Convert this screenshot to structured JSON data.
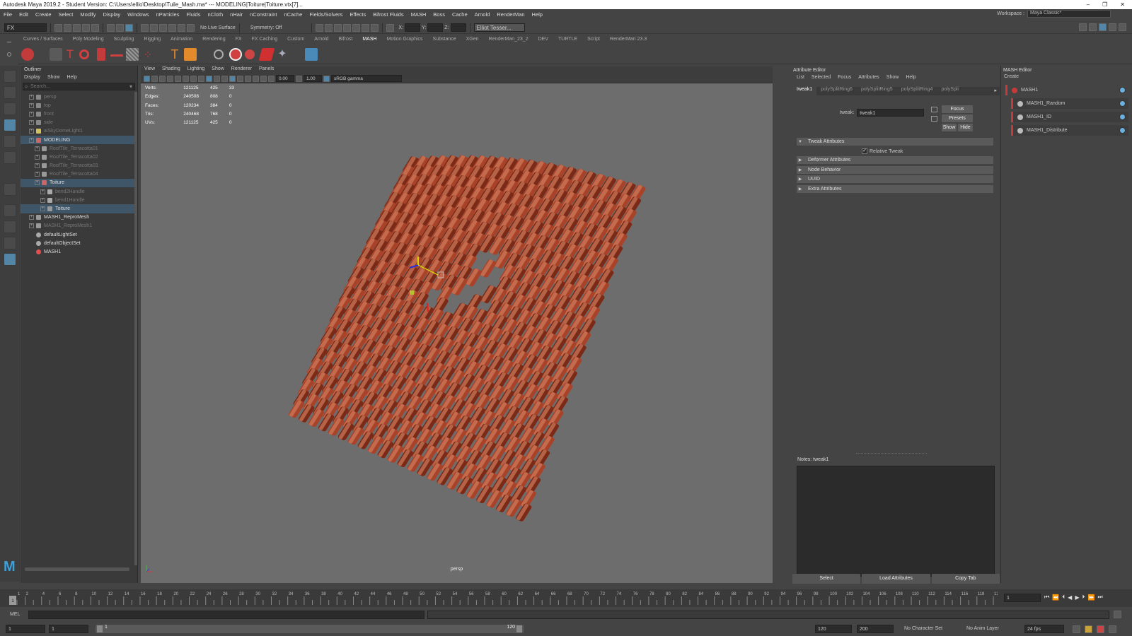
{
  "window": {
    "title": "Autodesk Maya 2019.2 - Student Version: C:\\Users\\ellio\\Desktop\\Tuile_Mash.ma* --- MODELING|Toiture|Toiture.vtx[7]...",
    "controls": [
      "–",
      "❐",
      "✕"
    ]
  },
  "menubar": [
    "File",
    "Edit",
    "Create",
    "Select",
    "Modify",
    "Display",
    "Windows",
    "nParticles",
    "Fluids",
    "nCloth",
    "nHair",
    "nConstraint",
    "nCache",
    "Fields/Solvers",
    "Effects",
    "Bifrost Fluids",
    "MASH",
    "Boss",
    "Cache",
    "Arnold",
    "RenderMan",
    "Help"
  ],
  "workspace": {
    "label": "Workspace :",
    "value": "Maya Classic*"
  },
  "statusline": {
    "mode": "FX",
    "live_surface": "No Live Surface",
    "symmetry": "Symmetry: Off",
    "x_label": "X:",
    "y_label": "Y:",
    "z_label": "Z:",
    "user": "Elliot Tesser..."
  },
  "shelf_tabs": [
    "Curves / Surfaces",
    "Poly Modeling",
    "Sculpting",
    "Rigging",
    "Animation",
    "Rendering",
    "FX",
    "FX Caching",
    "Custom",
    "Arnold",
    "Bifrost",
    "MASH",
    "Motion Graphics",
    "Substance",
    "XGen",
    "RenderMan_23_2",
    "DEV",
    "TURTLE",
    "Script",
    "RenderMan 23.3"
  ],
  "shelf_active": "MASH",
  "outliner": {
    "title": "Outliner",
    "menu": [
      "Display",
      "Show",
      "Help"
    ],
    "search_placeholder": "Search...",
    "items": [
      {
        "label": "persp",
        "indent": 0,
        "dim": true,
        "icon": "camera"
      },
      {
        "label": "top",
        "indent": 0,
        "dim": true,
        "icon": "camera"
      },
      {
        "label": "front",
        "indent": 0,
        "dim": true,
        "icon": "camera"
      },
      {
        "label": "side",
        "indent": 0,
        "dim": true,
        "icon": "camera"
      },
      {
        "label": "aiSkyDomeLight1",
        "indent": 0,
        "dim": true,
        "icon": "light"
      },
      {
        "label": "MODELING",
        "indent": 0,
        "selected": true,
        "icon": "group"
      },
      {
        "label": "RoofTile_Terracotta01",
        "indent": 1,
        "dim": true,
        "icon": "mesh"
      },
      {
        "label": "RoofTile_Terracotta02",
        "indent": 1,
        "dim": true,
        "icon": "mesh"
      },
      {
        "label": "RoofTile_Terracotta03",
        "indent": 1,
        "dim": true,
        "icon": "mesh"
      },
      {
        "label": "RoofTile_Terracotta04",
        "indent": 1,
        "dim": true,
        "icon": "mesh"
      },
      {
        "label": "Toiture",
        "indent": 1,
        "selected": true,
        "icon": "group"
      },
      {
        "label": "bend2Handle",
        "indent": 2,
        "dim": true,
        "icon": "handle"
      },
      {
        "label": "bend1Handle",
        "indent": 2,
        "dim": true,
        "icon": "handle"
      },
      {
        "label": "Toiture",
        "indent": 2,
        "selected": true,
        "icon": "mesh"
      },
      {
        "label": "MASH1_ReproMesh",
        "indent": 0,
        "icon": "mesh"
      },
      {
        "label": "MASH1_ReproMesh1",
        "indent": 0,
        "dim": true,
        "icon": "mesh"
      },
      {
        "label": "defaultLightSet",
        "indent": 0,
        "icon": "set"
      },
      {
        "label": "defaultObjectSet",
        "indent": 0,
        "icon": "set"
      },
      {
        "label": "MASH1",
        "indent": 0,
        "icon": "mash"
      }
    ]
  },
  "viewport": {
    "menu": [
      "View",
      "Shading",
      "Lighting",
      "Show",
      "Renderer",
      "Panels"
    ],
    "exposure": "0.00",
    "gamma": "1.00",
    "color_space": "sRGB gamma",
    "camera_label": "persp",
    "hud": [
      {
        "label": "Verts:",
        "a": "121125",
        "b": "425",
        "c": "33"
      },
      {
        "label": "Edges:",
        "a": "240508",
        "b": "808",
        "c": "0"
      },
      {
        "label": "Faces:",
        "a": "120234",
        "b": "384",
        "c": "0"
      },
      {
        "label": "Tris:",
        "a": "240468",
        "b": "768",
        "c": "0"
      },
      {
        "label": "UVs:",
        "a": "121125",
        "b": "425",
        "c": "0"
      }
    ]
  },
  "attribute_editor": {
    "title": "Attribute Editor",
    "menu": [
      "List",
      "Selected",
      "Focus",
      "Attributes",
      "Show",
      "Help"
    ],
    "tabs": [
      "tweak1",
      "polySplitRing6",
      "polySplitRing5",
      "polySplitRing4",
      "polySpli"
    ],
    "node_label": "tweak:",
    "node_value": "tweak1",
    "focus": "Focus",
    "presets": "Presets",
    "show": "Show",
    "hide": "Hide",
    "sections": [
      {
        "label": "Tweak Attributes",
        "open": true
      },
      {
        "label": "Deformer Attributes",
        "open": false
      },
      {
        "label": "Node Behavior",
        "open": false
      },
      {
        "label": "UUID",
        "open": false
      },
      {
        "label": "Extra Attributes",
        "open": false
      }
    ],
    "relative_tweak": "Relative Tweak",
    "notes": "Notes:  tweak1",
    "buttons": [
      "Select",
      "Load Attributes",
      "Copy Tab"
    ]
  },
  "mash_editor": {
    "title": "MASH Editor",
    "menu": "Create",
    "nodes": [
      "MASH1",
      "MASH1_Random",
      "MASH1_ID",
      "MASH1_Distribute"
    ]
  },
  "timeline": {
    "ticks": [
      "1",
      "2",
      "4",
      "6",
      "8",
      "10",
      "12",
      "14",
      "16",
      "18",
      "20",
      "22",
      "24",
      "26",
      "28",
      "30",
      "32",
      "34",
      "36",
      "38",
      "40",
      "42",
      "44",
      "46",
      "48",
      "50",
      "52",
      "54",
      "56",
      "58",
      "60",
      "62",
      "64",
      "66",
      "68",
      "70",
      "72",
      "74",
      "76",
      "78",
      "80",
      "82",
      "84",
      "86",
      "88",
      "90",
      "92",
      "94",
      "96",
      "98",
      "100",
      "102",
      "104",
      "106",
      "108",
      "110",
      "112",
      "114",
      "116",
      "118",
      "120"
    ],
    "current": "1"
  },
  "cmdline": {
    "label": "MEL"
  },
  "range": {
    "start": "1",
    "start2": "1",
    "handle_start": "1",
    "handle_end": "120",
    "end": "120",
    "end2": "200",
    "char_set": "No Character Set",
    "anim_layer": "No Anim Layer",
    "fps": "24 fps"
  },
  "colors": {
    "tile_dark": "#7a2a16",
    "tile_mid": "#a8432a",
    "tile_light": "#d07a5c",
    "accent": "#5285a6",
    "mash_red": "#c73a3a"
  }
}
